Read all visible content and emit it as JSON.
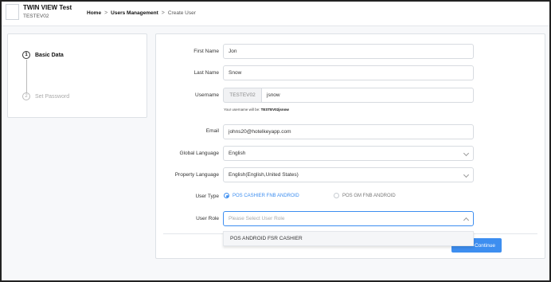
{
  "header": {
    "app_title": "TWIN VIEW Test",
    "app_subtitle": "TESTEV02",
    "breadcrumb": {
      "home": "Home",
      "separator1": ">",
      "users_management": "Users Management",
      "separator2": ">",
      "current": "Create User"
    }
  },
  "steps": [
    {
      "number": "1",
      "label": "Basic Data"
    },
    {
      "number": "2",
      "label": "Set Password"
    }
  ],
  "form": {
    "first_name": {
      "label": "First Name",
      "value": "Jon"
    },
    "last_name": {
      "label": "Last Name",
      "value": "Snow"
    },
    "username": {
      "label": "Username",
      "prefix": "TESTEV02",
      "value": "jsnow",
      "helper_text": "Your username will be:",
      "helper_value": "TESTEV02jsnow"
    },
    "email": {
      "label": "Email",
      "value": "johns20@hotelkeyapp.com"
    },
    "global_language": {
      "label": "Global Language",
      "value": "English"
    },
    "property_language": {
      "label": "Property Language",
      "value": "English(English,United States)"
    },
    "user_type": {
      "label": "User Type",
      "options": [
        {
          "label": "POS CASHIER FNB ANDROID",
          "selected": true
        },
        {
          "label": "POS GM FNB ANDROID",
          "selected": false
        }
      ]
    },
    "user_role": {
      "label": "User Role",
      "placeholder": "Please Select User Role",
      "dropdown_options": [
        "POS ANDROID FSR CASHIER"
      ]
    }
  },
  "actions": {
    "continue_label": "Continue"
  },
  "colors": {
    "accent": "#3d8ef0",
    "background": "#f7f8fa",
    "border": "#dde1e6"
  }
}
